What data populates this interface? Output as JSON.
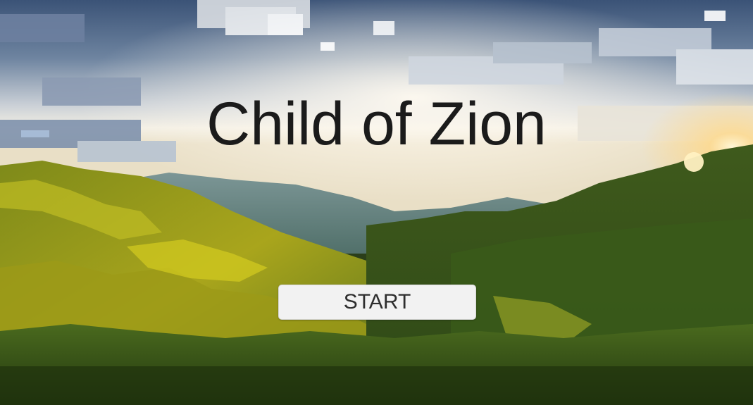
{
  "title": "Child of Zion",
  "start_button": {
    "label": "START"
  },
  "background": {
    "scene": "pixelated-landscape",
    "colors": {
      "sky_top": "#3d5577",
      "sky_mid": "#9aa9bd",
      "sky_glow": "#fbf6e8",
      "sun": "#ffd27a",
      "far_hills": "#5f7d7e",
      "hill_green": "#4d6a1e",
      "hill_yellow": "#b6b31d",
      "foreground": "#2c4318"
    }
  }
}
